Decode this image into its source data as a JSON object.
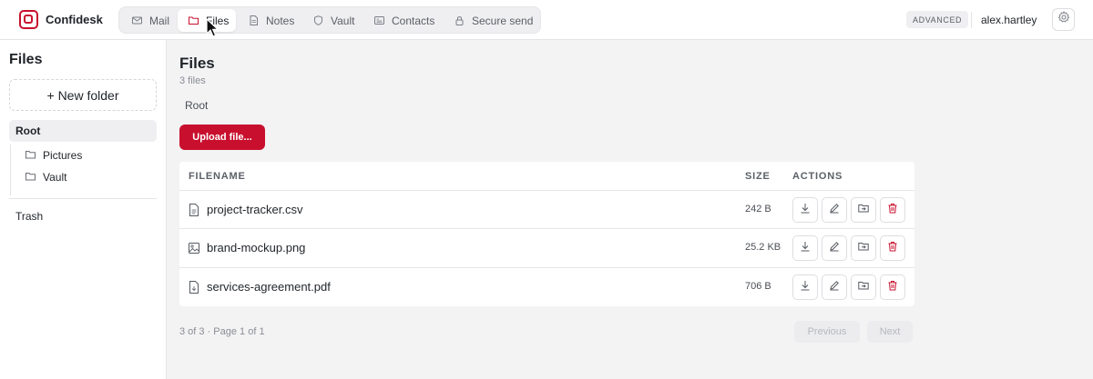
{
  "app": {
    "name": "Confidesk",
    "accent": "#c8102e"
  },
  "nav": {
    "tabs": [
      {
        "label": "Mail",
        "icon": "mail-icon"
      },
      {
        "label": "Files",
        "icon": "folder-icon",
        "active": true
      },
      {
        "label": "Notes",
        "icon": "note-icon"
      },
      {
        "label": "Vault",
        "icon": "shield-icon"
      },
      {
        "label": "Contacts",
        "icon": "contact-card-icon"
      },
      {
        "label": "Secure send",
        "icon": "lock-icon"
      }
    ]
  },
  "header": {
    "badge": "ADVANCED",
    "user": "alex.hartley",
    "settings_icon": "gear-icon"
  },
  "sidebar": {
    "title": "Files",
    "new_folder": "+ New folder",
    "root": "Root",
    "folders": [
      "Pictures",
      "Vault"
    ],
    "trash": "Trash"
  },
  "main": {
    "title": "Files",
    "subtitle": "3 files",
    "breadcrumb": "Root",
    "upload": "Upload file..."
  },
  "table": {
    "headers": {
      "filename": "FILENAME",
      "size": "SIZE",
      "actions": "ACTIONS"
    },
    "rows": [
      {
        "name": "project-tracker.csv",
        "size": "242 B",
        "icon": "document-icon"
      },
      {
        "name": "brand-mockup.png",
        "size": "25.2 KB",
        "icon": "image-icon"
      },
      {
        "name": "services-agreement.pdf",
        "size": "706 B",
        "icon": "pdf-icon"
      }
    ],
    "action_icons": [
      "download-icon",
      "pencil-icon",
      "move-folder-icon",
      "trash-icon"
    ]
  },
  "pagination": {
    "info": "3 of 3 · Page 1 of 1",
    "previous": "Previous",
    "next": "Next"
  }
}
